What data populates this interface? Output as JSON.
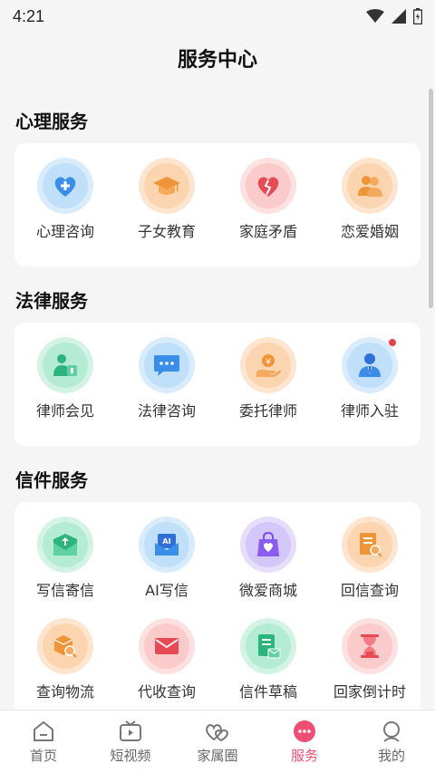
{
  "status": {
    "time": "4:21"
  },
  "header": {
    "title": "服务中心"
  },
  "sections": [
    {
      "title": "心理服务",
      "items": [
        {
          "label": "心理咨询",
          "icon": "heart-plus-icon",
          "color": "blue"
        },
        {
          "label": "子女教育",
          "icon": "graduation-cap-icon",
          "color": "orange"
        },
        {
          "label": "家庭矛盾",
          "icon": "broken-heart-icon",
          "color": "pink"
        },
        {
          "label": "恋爱婚姻",
          "icon": "couple-icon",
          "color": "orange"
        }
      ]
    },
    {
      "title": "法律服务",
      "items": [
        {
          "label": "律师会见",
          "icon": "lawyer-meeting-icon",
          "color": "green"
        },
        {
          "label": "法律咨询",
          "icon": "chat-bubble-icon",
          "color": "blue"
        },
        {
          "label": "委托律师",
          "icon": "hand-coin-icon",
          "color": "orange"
        },
        {
          "label": "律师入驻",
          "icon": "lawyer-icon",
          "color": "blue"
        }
      ]
    },
    {
      "title": "信件服务",
      "items": [
        {
          "label": "写信寄信",
          "icon": "envelope-upload-icon",
          "color": "green"
        },
        {
          "label": "AI写信",
          "icon": "ai-envelope-icon",
          "color": "blue"
        },
        {
          "label": "微爱商城",
          "icon": "shopping-bag-icon",
          "color": "purple"
        },
        {
          "label": "回信查询",
          "icon": "document-search-icon",
          "color": "orange"
        },
        {
          "label": "查询物流",
          "icon": "package-search-icon",
          "color": "orange"
        },
        {
          "label": "代收查询",
          "icon": "mail-icon",
          "color": "pink"
        },
        {
          "label": "信件草稿",
          "icon": "draft-mail-icon",
          "color": "green"
        },
        {
          "label": "回家倒计时",
          "icon": "hourglass-icon",
          "color": "pink"
        }
      ]
    }
  ],
  "bottom_nav": [
    {
      "label": "首页",
      "icon": "home-icon"
    },
    {
      "label": "短视频",
      "icon": "video-icon"
    },
    {
      "label": "家属圈",
      "icon": "hearts-icon"
    },
    {
      "label": "服务",
      "icon": "service-icon",
      "active": true
    },
    {
      "label": "我的",
      "icon": "profile-icon"
    }
  ],
  "colors": {
    "accent": "#ef4f72",
    "page_bg": "#f5f5f5"
  }
}
